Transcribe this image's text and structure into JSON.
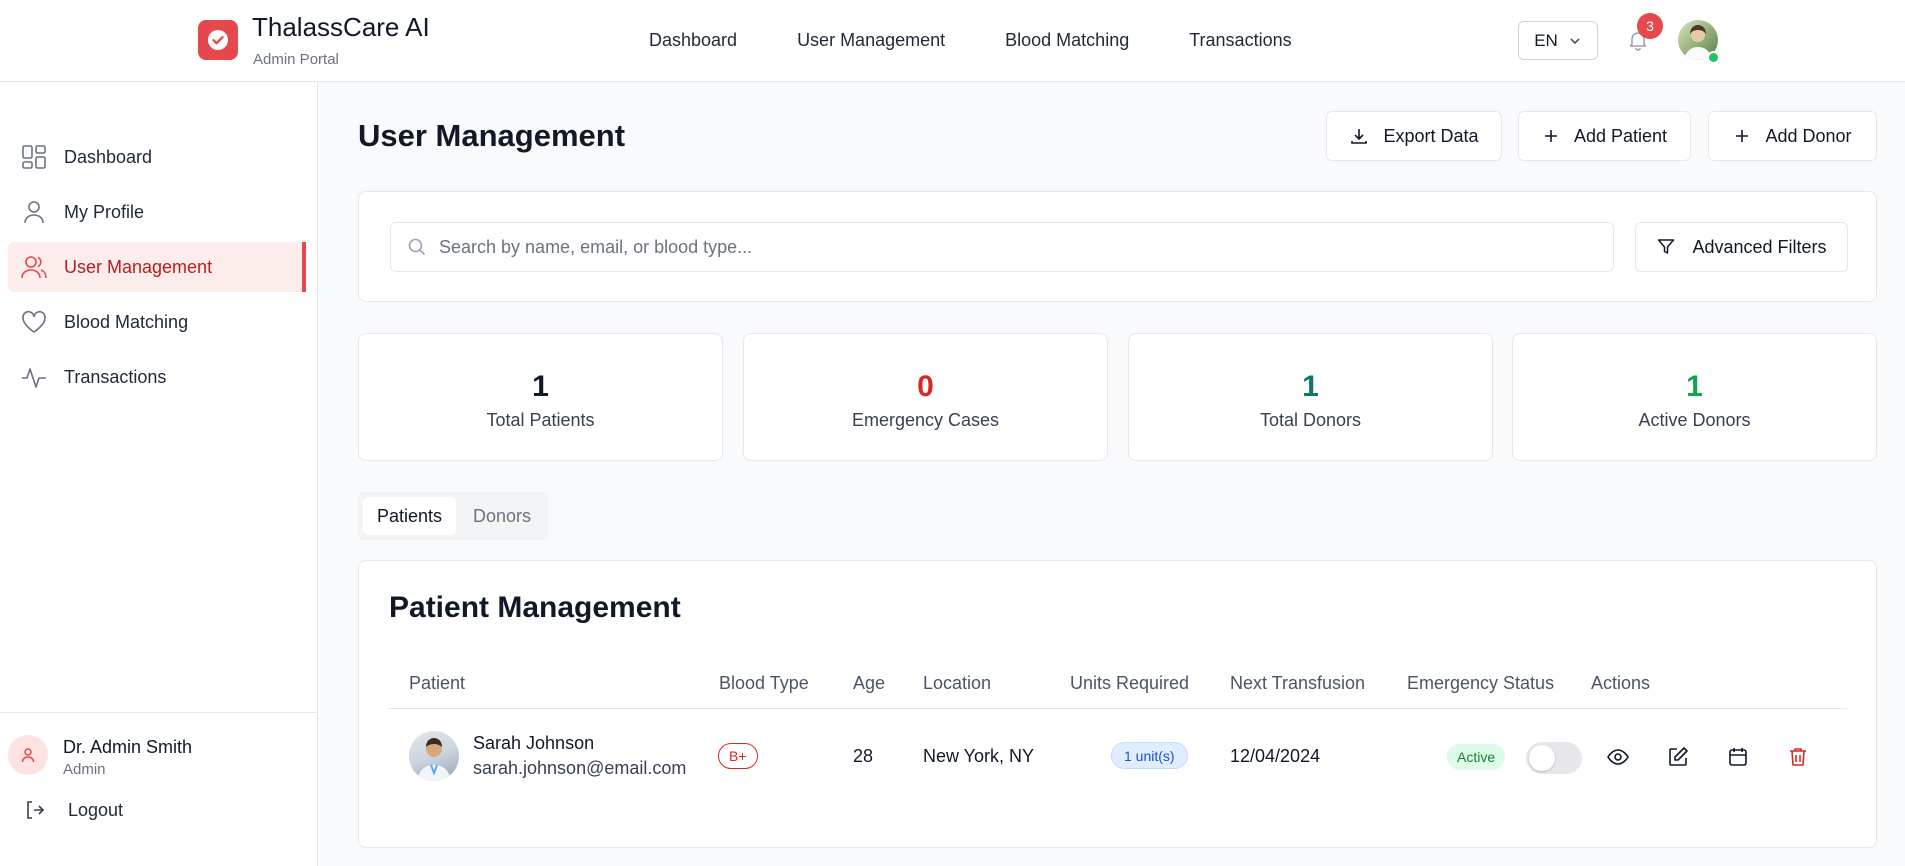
{
  "header": {
    "app_title": "ThalassCare AI",
    "app_subtitle": "Admin Portal",
    "nav": [
      "Dashboard",
      "User Management",
      "Blood Matching",
      "Transactions"
    ],
    "language": "EN",
    "notification_count": "3"
  },
  "sidebar": {
    "items": [
      {
        "label": "Dashboard",
        "icon": "grid-icon"
      },
      {
        "label": "My Profile",
        "icon": "user-icon"
      },
      {
        "label": "User Management",
        "icon": "users-icon",
        "active": true
      },
      {
        "label": "Blood Matching",
        "icon": "heart-icon"
      },
      {
        "label": "Transactions",
        "icon": "activity-icon"
      }
    ],
    "user": {
      "name": "Dr. Admin Smith",
      "role": "Admin"
    },
    "logout_label": "Logout"
  },
  "main": {
    "title": "User Management",
    "export_label": "Export Data",
    "add_patient_label": "Add Patient",
    "add_donor_label": "Add Donor",
    "search": {
      "placeholder": "Search by name, email, or blood type...",
      "value": ""
    },
    "filters_label": "Advanced Filters",
    "stats": [
      {
        "value": "1",
        "label": "Total Patients",
        "color": "#111827"
      },
      {
        "value": "0",
        "label": "Emergency Cases",
        "color": "#dc2626"
      },
      {
        "value": "1",
        "label": "Total Donors",
        "color": "#0f766e"
      },
      {
        "value": "1",
        "label": "Active Donors",
        "color": "#16a34a"
      }
    ],
    "tabs": [
      "Patients",
      "Donors"
    ],
    "table": {
      "title": "Patient Management",
      "headers": [
        "Patient",
        "Blood Type",
        "Age",
        "Location",
        "Units Required",
        "Next Transfusion",
        "Emergency Status",
        "Actions"
      ],
      "rows": [
        {
          "name": "Sarah Johnson",
          "email": "sarah.johnson@email.com",
          "blood_type": "B+",
          "age": "28",
          "location": "New York, NY",
          "units": "1 unit(s)",
          "next_transfusion": "12/04/2024",
          "status": "Active",
          "emergency_toggle": false
        }
      ]
    }
  }
}
